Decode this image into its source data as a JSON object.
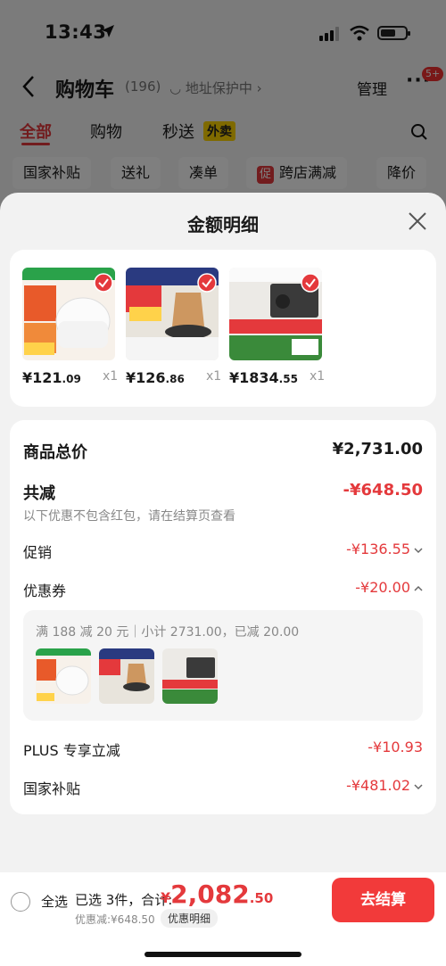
{
  "status": {
    "time": "13:43"
  },
  "nav": {
    "title": "购物车",
    "count": "(196)",
    "address": "◡ 地址保护中 ›",
    "manage": "管理",
    "more": "···",
    "badge": "5+"
  },
  "tabs": [
    {
      "label": "全部"
    },
    {
      "label": "购物"
    },
    {
      "label": "秒送"
    }
  ],
  "tab_tag": "外卖",
  "chips": [
    {
      "label": "国家补贴"
    },
    {
      "label": "送礼"
    },
    {
      "label": "凑单"
    },
    {
      "label": "跨店满减",
      "flag": "促"
    },
    {
      "label": "降价"
    }
  ],
  "sheet": {
    "title": "金额明细"
  },
  "products": [
    {
      "price_int": "¥121",
      "price_dec": ".09",
      "qty": "x1",
      "thumb_color": "#f5f0ea"
    },
    {
      "price_int": "¥126",
      "price_dec": ".86",
      "qty": "x1",
      "thumb_color": "#2a3a60"
    },
    {
      "price_int": "¥1834",
      "price_dec": ".55",
      "qty": "x1",
      "thumb_color": "#3a3a3a"
    }
  ],
  "detail": {
    "total_label": "商品总价",
    "total_value": "¥2,731.00",
    "reduce_label": "共减",
    "reduce_value": "-¥648.50",
    "reduce_note": "以下优惠不包含红包，请在结算页查看",
    "promo_label": "促销",
    "promo_value": "-¥136.55",
    "coupon_label": "优惠券",
    "coupon_value": "-¥20.00",
    "coupon_detail": "满 188 减 20 元｜小计 2731.00，已减 20.00",
    "plus_label": "PLUS 专享立减",
    "plus_value": "-¥10.93",
    "subsidy_label": "国家补贴",
    "subsidy_value": "-¥481.02"
  },
  "bottom": {
    "select_all": "全选",
    "selected_text": "已选 3件，合计:",
    "total_currency": "¥",
    "total_int": "2,082",
    "total_dec": ".50",
    "discount": "优惠减:¥648.50",
    "detail_link": "优惠明细",
    "checkout": "去结算"
  },
  "colors": {
    "accent": "#e4393c",
    "checkout": "#f23a3a"
  }
}
